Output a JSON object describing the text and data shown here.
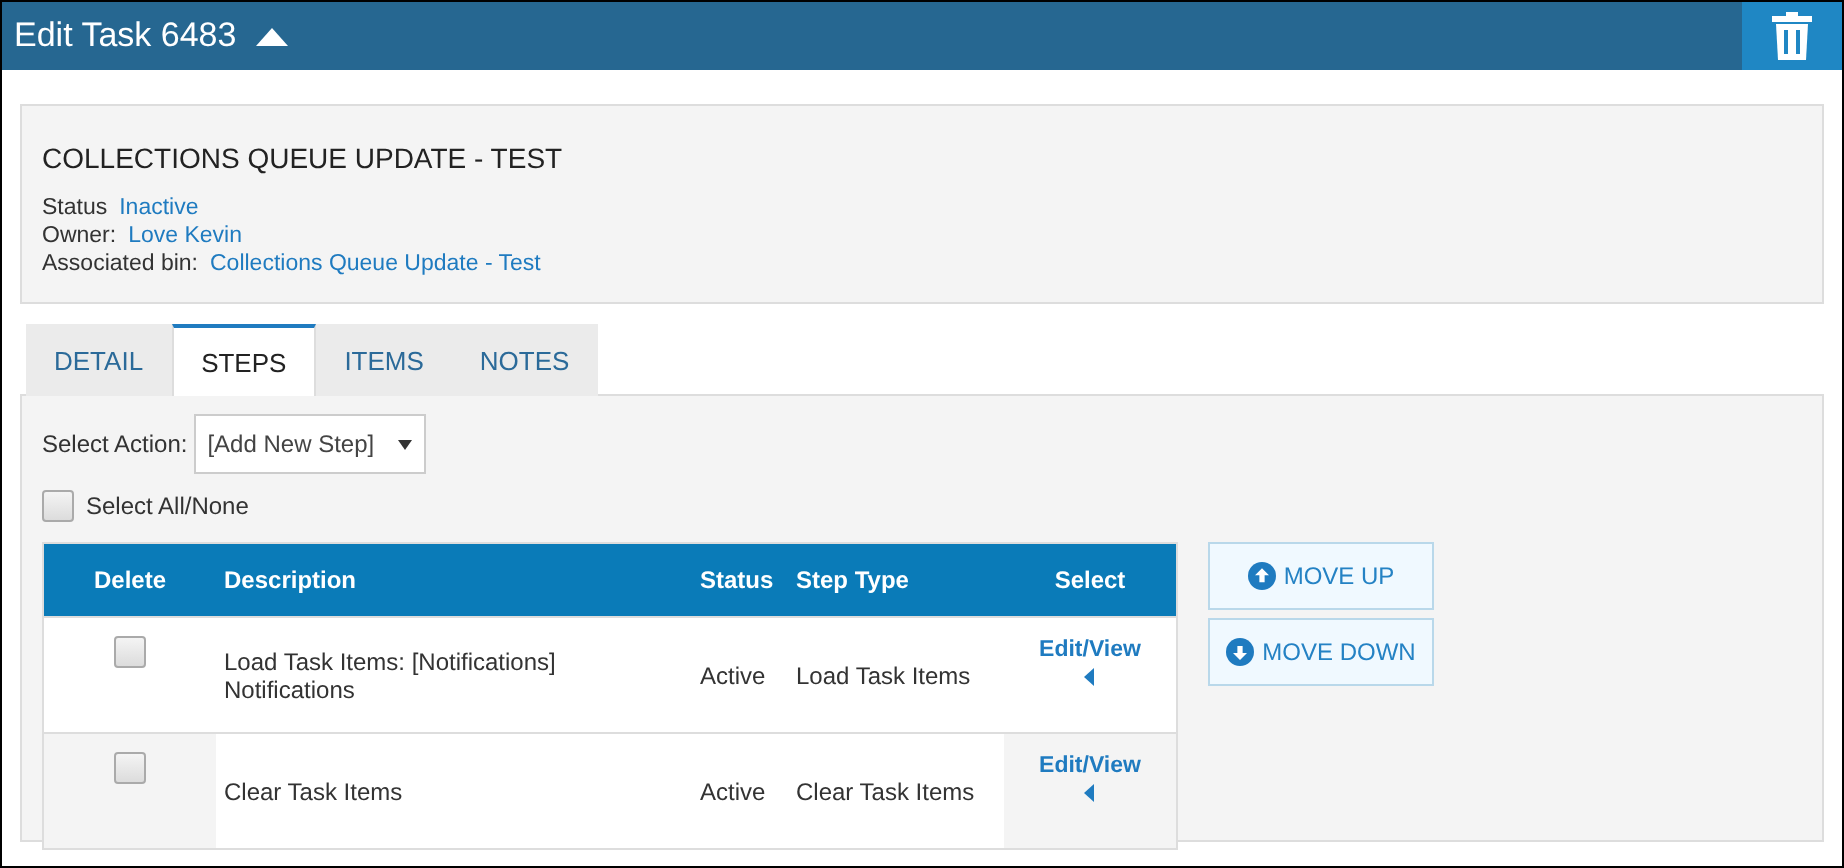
{
  "header": {
    "title": "Edit Task 6483"
  },
  "summary": {
    "title": "COLLECTIONS QUEUE UPDATE - TEST",
    "fields": [
      {
        "label": "Status",
        "value": "Inactive"
      },
      {
        "label": "Owner:",
        "value": "Love Kevin"
      },
      {
        "label": "Associated bin:",
        "value": "Collections Queue Update - Test"
      }
    ]
  },
  "tabs": [
    {
      "label": "DETAIL",
      "selected": false
    },
    {
      "label": "STEPS",
      "selected": true
    },
    {
      "label": "ITEMS",
      "selected": false
    },
    {
      "label": "NOTES",
      "selected": false
    }
  ],
  "action": {
    "label": "Select Action:",
    "value": "[Add New Step]"
  },
  "select_all": {
    "label": "Select All/None",
    "checked": false
  },
  "table": {
    "columns": [
      "Delete",
      "Description",
      "Status",
      "Step Type",
      "Select"
    ],
    "rows": [
      {
        "checked": false,
        "description": "Load Task Items: [Notifications] Notifications",
        "status": "Active",
        "step_type": "Load Task Items",
        "select": "Edit/View"
      },
      {
        "checked": false,
        "description": "Clear Task Items",
        "status": "Active",
        "step_type": "Clear Task Items",
        "select": "Edit/View"
      }
    ]
  },
  "buttons": [
    {
      "label": "MOVE UP",
      "kind": "up"
    },
    {
      "label": "MOVE DOWN",
      "kind": "down"
    }
  ]
}
